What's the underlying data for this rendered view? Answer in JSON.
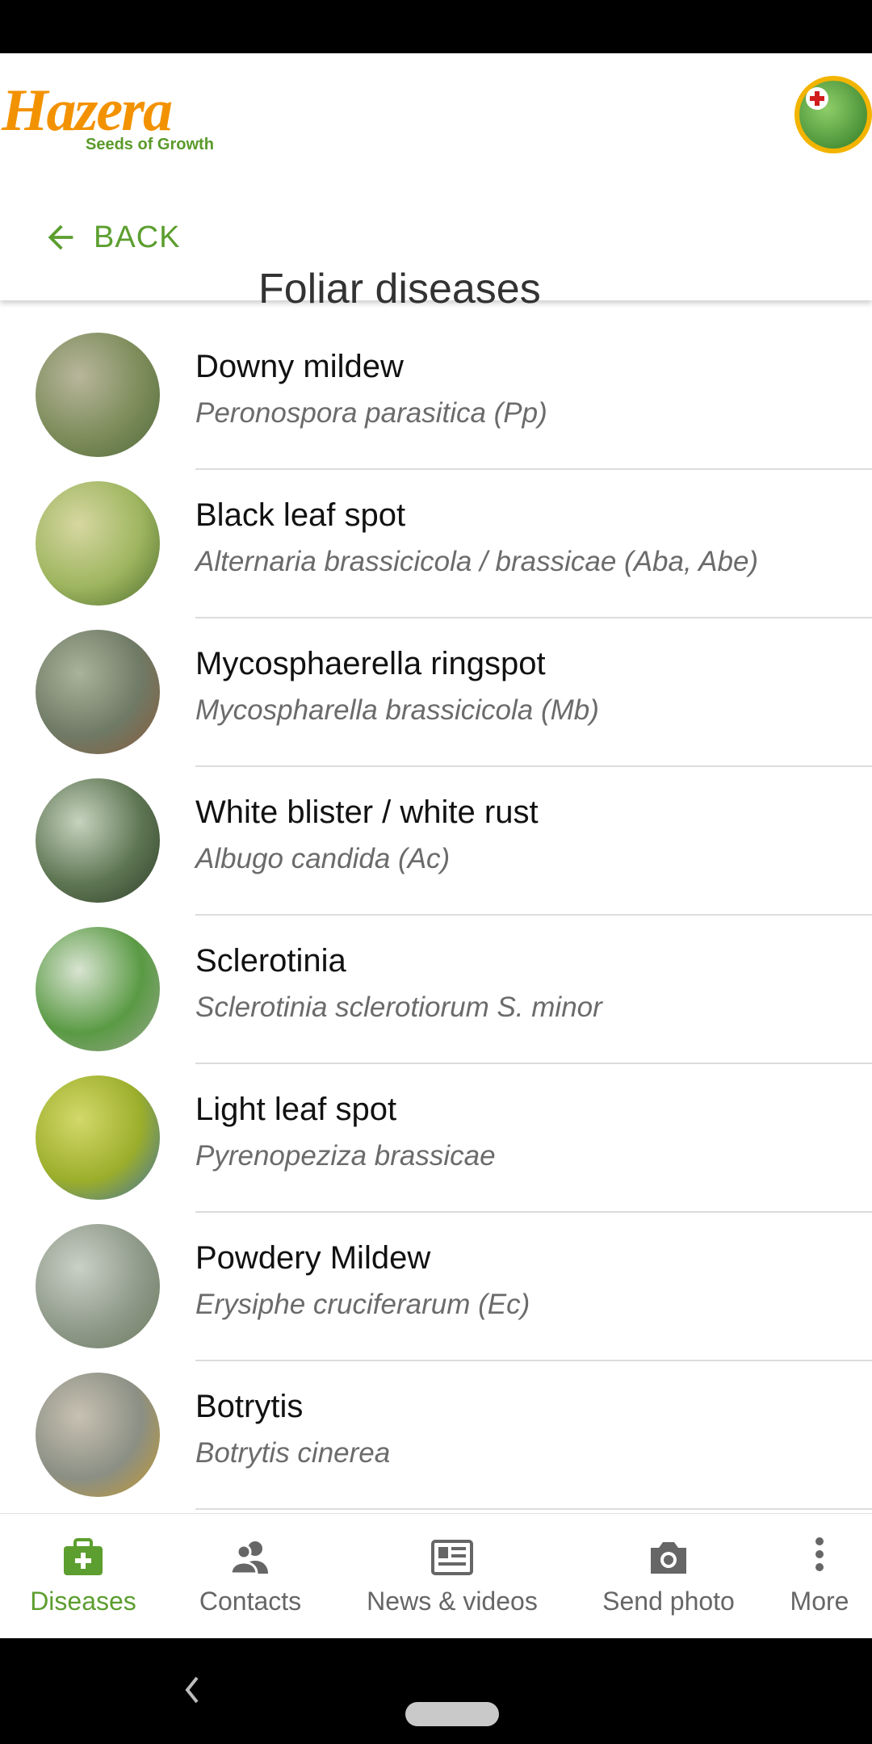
{
  "app": {
    "logo_word": "Hazera",
    "logo_tagline": "Seeds of Growth"
  },
  "header": {
    "back_label": "BACK",
    "title": "Foliar diseases"
  },
  "diseases": [
    {
      "name": "Downy mildew",
      "latin": "Peronospora parasitica (Pp)",
      "thumb": [
        "#7d8c5a",
        "#b8b69c",
        "#4f6a3b"
      ]
    },
    {
      "name": "Black leaf spot",
      "latin": "Alternaria brassicicola / brassicae (Aba, Abe)",
      "thumb": [
        "#9eb55f",
        "#d6d7a1",
        "#4a6b2b"
      ]
    },
    {
      "name": "Mycosphaerella ringspot",
      "latin": "Mycospharella brassicicola (Mb)",
      "thumb": [
        "#6f7a66",
        "#a9b39a",
        "#8a5a3a"
      ]
    },
    {
      "name": "White blister / white rust",
      "latin": "Albugo candida (Ac)",
      "thumb": [
        "#5e7552",
        "#c6d3bf",
        "#2f3f2a"
      ]
    },
    {
      "name": "Sclerotinia",
      "latin": "Sclerotinia sclerotiorum S. minor",
      "thumb": [
        "#5a9a44",
        "#d9e4d2",
        "#9aa78f"
      ]
    },
    {
      "name": "Light leaf spot",
      "latin": "Pyrenopeziza brassicae",
      "thumb": [
        "#9bae2b",
        "#d3d86a",
        "#3b6fa8"
      ]
    },
    {
      "name": "Powdery Mildew",
      "latin": "Erysiphe cruciferarum (Ec)",
      "thumb": [
        "#8f9a8a",
        "#c9d0c6",
        "#6b7a5e"
      ]
    },
    {
      "name": "Botrytis",
      "latin": "Botrytis cinerea",
      "thumb": [
        "#8b8f84",
        "#c7c1b2",
        "#c59a2e"
      ]
    }
  ],
  "bottom_nav": {
    "items": [
      {
        "label": "Diseases",
        "icon": "medical-kit-icon",
        "active": true
      },
      {
        "label": "Contacts",
        "icon": "contacts-icon",
        "active": false
      },
      {
        "label": "News & videos",
        "icon": "newspaper-icon",
        "active": false
      },
      {
        "label": "Send photo",
        "icon": "camera-icon",
        "active": false
      },
      {
        "label": "More",
        "icon": "more-vertical-icon",
        "active": false
      }
    ]
  },
  "colors": {
    "brand_green": "#5c9e2f",
    "brand_orange": "#f39200",
    "text_secondary": "#6b6b6b"
  }
}
